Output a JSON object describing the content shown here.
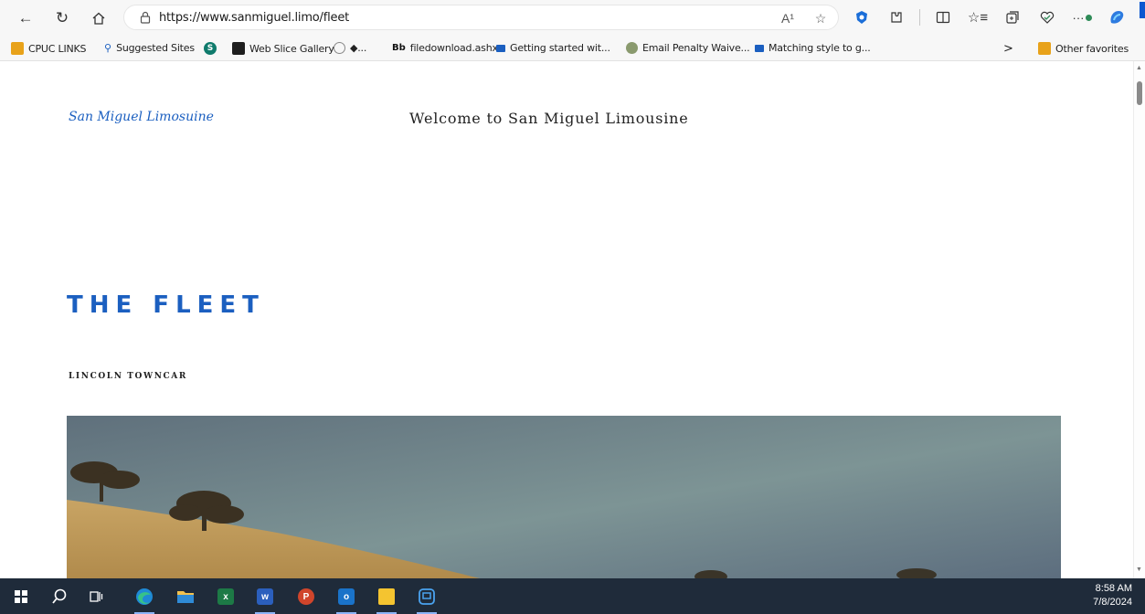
{
  "browser": {
    "url": "https://www.sanmiguel.limo/fleet",
    "read_aloud_label": "A¹",
    "more_label": "···"
  },
  "favorites": [
    {
      "label": "CPUC LINKS",
      "icon": "folder-icon",
      "color": "#e8a21a"
    },
    {
      "label": "Suggested Sites",
      "icon": "search-icon",
      "color": "#1b5fc0"
    },
    {
      "label": "",
      "icon": "sharepoint-icon",
      "color": "#0f7b6c"
    },
    {
      "label": "Web Slice Gallery",
      "icon": "web-slice-icon",
      "color": "#1e1e1e"
    },
    {
      "label": "◆...",
      "icon": "clock-icon",
      "color": "#777777"
    },
    {
      "label": "filedownload.ashx",
      "icon": "blackboard-icon",
      "color": "#111111"
    },
    {
      "label": "Getting started wit...",
      "icon": "video-icon",
      "color": "#1b5fc0"
    },
    {
      "label": "Email Penalty Waive...",
      "icon": "globe-icon",
      "color": "#6b6b6b"
    },
    {
      "label": "Matching style to g...",
      "icon": "video-icon",
      "color": "#1b5fc0"
    }
  ],
  "favorites_more": ">",
  "other_favorites": "Other favorites",
  "page": {
    "logo": "San Miguel Limosuine",
    "welcome": "Welcome to San Miguel Limousine",
    "heading": "THE FLEET",
    "subheading": "LINCOLN TOWNCAR"
  },
  "colors": {
    "accent": "#1b5fc0",
    "taskbar": "#1f2b3a"
  },
  "taskbar": {
    "apps": [
      "windows-start-icon",
      "search-icon",
      "task-view-icon",
      "edge-icon",
      "file-explorer-icon",
      "excel-icon",
      "word-icon",
      "powerpoint-icon",
      "outlook-icon",
      "sticky-notes-icon",
      "app-icon"
    ],
    "time": "8:58 AM",
    "date": "7/8/2024"
  }
}
